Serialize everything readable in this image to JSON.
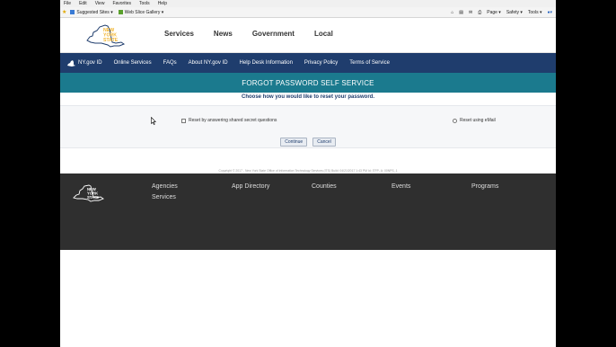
{
  "browser": {
    "menu": [
      "File",
      "Edit",
      "View",
      "Favorites",
      "Tools",
      "Help"
    ],
    "favorites": [
      "Suggested Sites ▾",
      "Web Slice Gallery ▾"
    ],
    "toolbar_right": [
      "Page ▾",
      "Safety ▾",
      "Tools ▾"
    ]
  },
  "header": {
    "logo_text": [
      "NEW",
      "YORK",
      "STATE"
    ],
    "nav": [
      "Services",
      "News",
      "Government",
      "Local"
    ]
  },
  "bluenav": [
    "NY.gov ID",
    "Online Services",
    "FAQs",
    "About NY.gov ID",
    "Help Desk Information",
    "Privacy Policy",
    "Terms of Service"
  ],
  "page": {
    "banner": "FORGOT PASSWORD SELF SERVICE",
    "subtitle": "Choose how you would like to reset your password.",
    "option_questions": "Reset by answering shared secret questions",
    "option_email": "Reset using eMail",
    "continue_label": "Continue",
    "cancel_label": "Cancel",
    "copyright": "Copyright © 2017 - New York State Office of Information Technology Services (ITS) Build: 04/21/2017 1:43 PM Id: ITFP- A: 00NPS_1"
  },
  "footer": {
    "links": [
      "Agencies",
      "App Directory",
      "Counties",
      "Events",
      "Programs",
      "Services"
    ]
  },
  "colors": {
    "navy": "#1f3d6d",
    "teal": "#1b7a8e",
    "footer": "#2f2f2f",
    "logo_gold": "#f2b531"
  }
}
